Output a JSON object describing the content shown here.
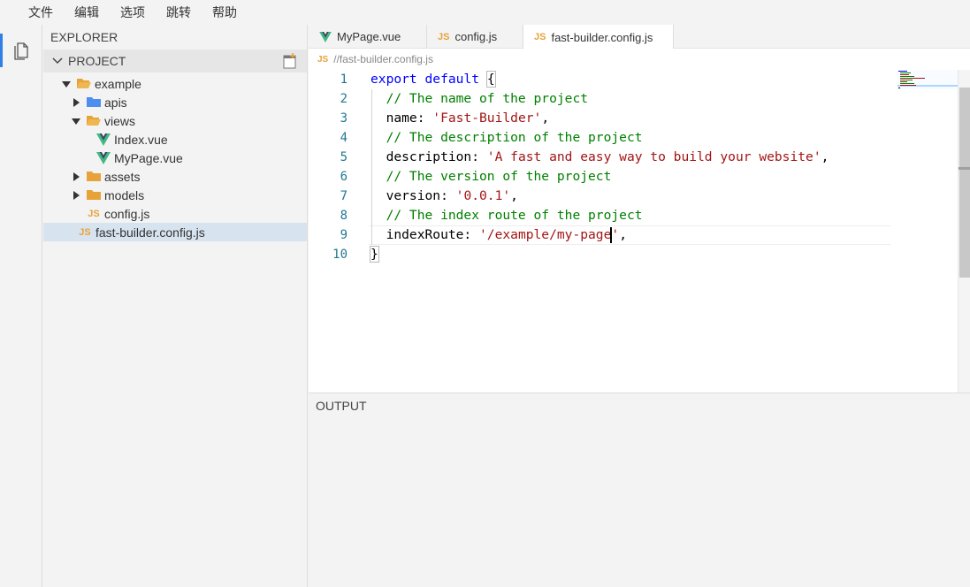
{
  "menu": {
    "items": [
      "文件",
      "编辑",
      "选项",
      "跳转",
      "帮助"
    ]
  },
  "sidebar": {
    "title": "EXPLORER",
    "section_label": "PROJECT",
    "tree": [
      {
        "label": "example",
        "type": "folder",
        "expanded": true
      },
      {
        "label": "apis",
        "type": "folder",
        "expanded": false
      },
      {
        "label": "views",
        "type": "folder",
        "expanded": true
      },
      {
        "label": "Index.vue",
        "type": "vue"
      },
      {
        "label": "MyPage.vue",
        "type": "vue"
      },
      {
        "label": "assets",
        "type": "folder",
        "expanded": false
      },
      {
        "label": "models",
        "type": "folder",
        "expanded": false
      },
      {
        "label": "config.js",
        "type": "js"
      },
      {
        "label": "fast-builder.config.js",
        "type": "js",
        "selected": true
      }
    ]
  },
  "tabs": [
    {
      "label": "MyPage.vue",
      "icon": "vue-icon"
    },
    {
      "label": "config.js",
      "icon": "js-icon"
    },
    {
      "label": "fast-builder.config.js",
      "icon": "js-icon",
      "active": true
    }
  ],
  "js_badge": "JS",
  "breadcrumb": {
    "path": "//fast-builder.config.js"
  },
  "editor": {
    "line_numbers": [
      "1",
      "2",
      "3",
      "4",
      "5",
      "6",
      "7",
      "8",
      "9",
      "10"
    ],
    "lines": {
      "l1_kw1": "export",
      "l1_kw2": "default",
      "l1_brace": "{",
      "l2": "  // The name of the project",
      "l3_key": "  name: ",
      "l3_val": "'Fast-Builder'",
      "l3_end": ",",
      "l4": "  // The description of the project",
      "l5_key": "  description: ",
      "l5_val": "'A fast and easy way to build your website'",
      "l5_end": ",",
      "l6": "  // The version of the project",
      "l7_key": "  version: ",
      "l7_val": "'0.0.1'",
      "l7_end": ",",
      "l8": "  // The index route of the project",
      "l9_key": "  indexRoute: ",
      "l9_val_a": "'/example/my-page",
      "l9_val_b": "'",
      "l9_end": ",",
      "l10": "}"
    },
    "current_line": 9
  },
  "output": {
    "title": "OUTPUT"
  },
  "colors": {
    "accent": "#2f7fe6",
    "folder": "#e8a23a",
    "folder_blue": "#4d8ef0",
    "vue_green": "#41b883",
    "vue_dark": "#35495e",
    "js_orange": "#e8a23a",
    "keyword": "#0000ff",
    "comment": "#008000",
    "string": "#a31515",
    "line_number": "#237893"
  }
}
